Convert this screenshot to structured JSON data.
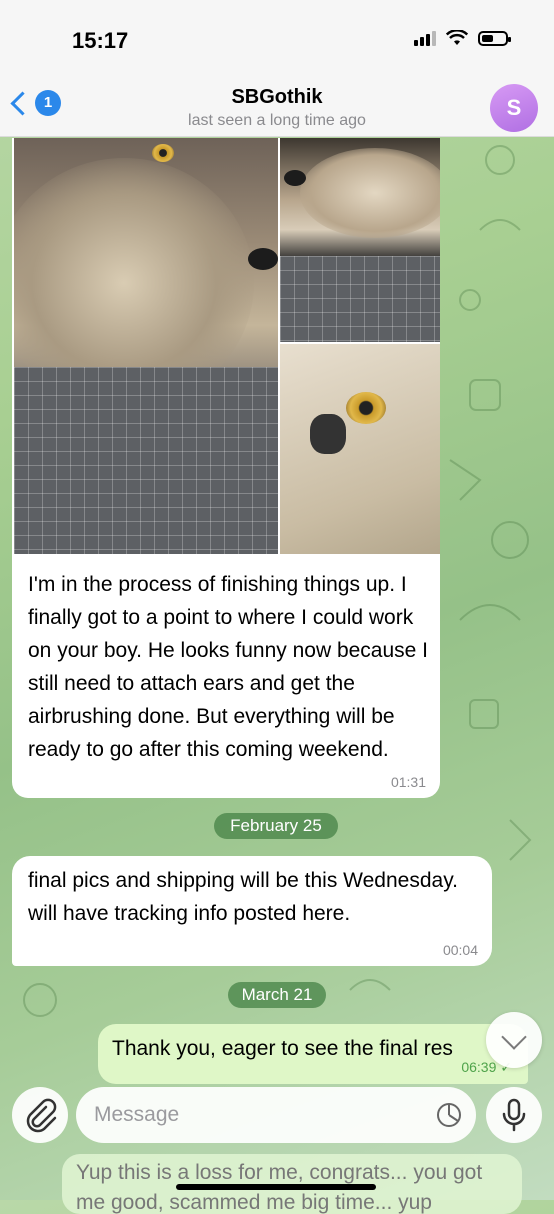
{
  "status_bar": {
    "time": "15:17",
    "battery_level": 0.5
  },
  "header": {
    "back_badge": "1",
    "contact_name": "SBGothik",
    "contact_status": "last seen a long time ago",
    "avatar_letter": "S",
    "accent_color": "#2b88ea"
  },
  "messages": [
    {
      "direction": "incoming",
      "has_photos": true,
      "photo_count": 3,
      "text": "I'm in the process of finishing things up. I finally got to a point to where I could work on your boy. He looks funny now because I still need to attach ears and get the airbrushing done. But everything will be ready to go after this coming weekend.",
      "time": "01:31"
    },
    {
      "type": "date",
      "label": "February 25"
    },
    {
      "direction": "incoming",
      "text": "final pics and shipping will be this Wednesday. will have tracking info posted here.",
      "time": "00:04"
    },
    {
      "type": "date",
      "label": "March 21"
    },
    {
      "direction": "outgoing",
      "text": "Thank you, eager to see the final res",
      "time": "06:39",
      "read": true
    }
  ],
  "input": {
    "placeholder": "Message",
    "draft_preview": "Yup this is a loss for me, congrats... you got me good, scammed me big time... yup"
  }
}
